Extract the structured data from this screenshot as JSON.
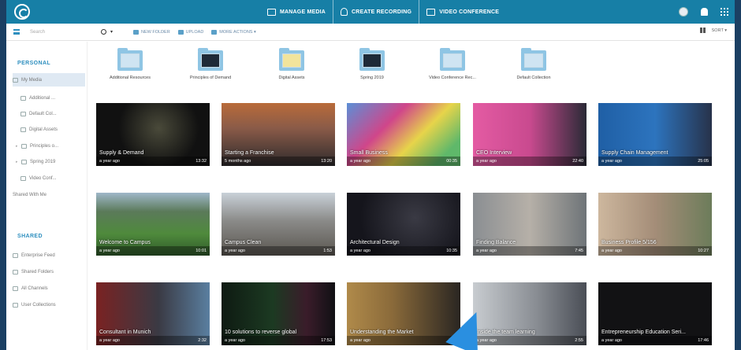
{
  "topbar": {
    "nav": [
      {
        "label": "MANAGE MEDIA",
        "icon": "media-icon"
      },
      {
        "label": "CREATE RECORDING",
        "icon": "recording-icon"
      },
      {
        "label": "VIDEO CONFERENCE",
        "icon": "video-conference-icon"
      }
    ]
  },
  "toolbar": {
    "search_placeholder": "Search",
    "new_folder": "NEW FOLDER",
    "upload": "UPLOAD",
    "more_actions": "MORE ACTIONS ▾",
    "sort": "SORT ▾"
  },
  "sidebar": {
    "personal_heading": "PERSONAL",
    "personal_items": [
      "My Media",
      "Additional ...",
      "Default Col...",
      "Digital Assets",
      "Principles o...",
      "Spring 2019",
      "Video Conf...",
      "Shared With Me"
    ],
    "shared_heading": "SHARED",
    "shared_items": [
      "Enterprise Feed",
      "Shared Folders",
      "All Channels",
      "User Collections"
    ]
  },
  "folders": [
    {
      "label": "Additional Resources"
    },
    {
      "label": "Principles of Demand"
    },
    {
      "label": "Digital Assets"
    },
    {
      "label": "Spring 2019"
    },
    {
      "label": "Video Conference Rec..."
    },
    {
      "label": "Default Collection"
    }
  ],
  "media": [
    {
      "title": "Supply & Demand",
      "age": "a year ago",
      "duration": "13:32"
    },
    {
      "title": "Starting a Franchise",
      "age": "5 months ago",
      "duration": "13:20"
    },
    {
      "title": "Small Business",
      "age": "a year ago",
      "duration": "00:35"
    },
    {
      "title": "CEO Interview",
      "age": "a year ago",
      "duration": "22:40"
    },
    {
      "title": "Supply Chain Management",
      "age": "a year ago",
      "duration": "25:05"
    },
    {
      "title": "Welcome to Campus",
      "age": "a year ago",
      "duration": "10:01"
    },
    {
      "title": "Campus Clean",
      "age": "a year ago",
      "duration": "1:53"
    },
    {
      "title": "Architectural Design",
      "age": "a year ago",
      "duration": "10:35"
    },
    {
      "title": "Finding Balance",
      "age": "a year ago",
      "duration": "7:45"
    },
    {
      "title": "Business Profile 5/156",
      "age": "a year ago",
      "duration": "10:27"
    },
    {
      "title": "Consultant in Munich",
      "age": "a year ago",
      "duration": "2:32"
    },
    {
      "title": "10 solutions to reverse global",
      "age": "a year ago",
      "duration": "17:53"
    },
    {
      "title": "Understanding the Market",
      "age": "a year ago",
      "duration": "2:47"
    },
    {
      "title": "Inside the team learning",
      "age": "a year ago",
      "duration": "2:55"
    },
    {
      "title": "Entrepreneurship Education Seri...",
      "age": "a year ago",
      "duration": "17:46"
    }
  ]
}
